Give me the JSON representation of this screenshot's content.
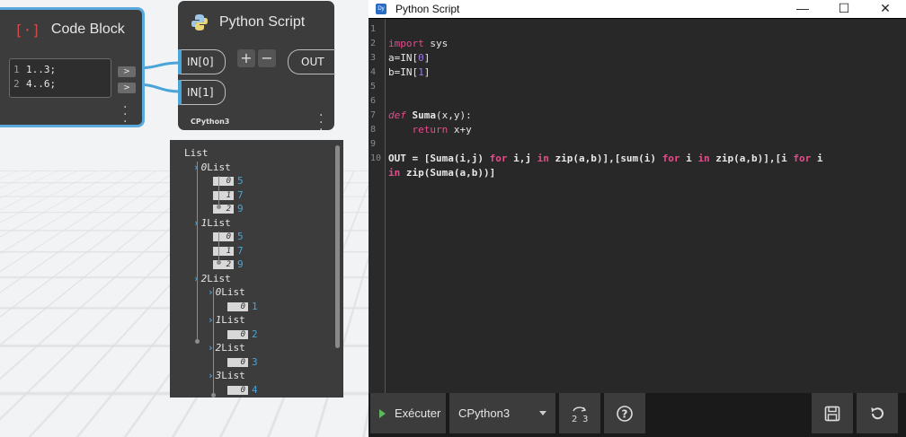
{
  "code_block": {
    "title": "Code Block",
    "icon": "code-block-icon",
    "lines": [
      {
        "num": "1",
        "text": "1..3;"
      },
      {
        "num": "2",
        "text": "4..6;"
      }
    ],
    "out_port_label": ">"
  },
  "python_node": {
    "title": "Python Script",
    "icon": "python-icon",
    "inputs": [
      "IN[0]",
      "IN[1]"
    ],
    "add_label": "+",
    "remove_label": "−",
    "output": "OUT",
    "engine": "CPython3"
  },
  "preview": {
    "rows": [
      {
        "kind": "header",
        "text": "List"
      },
      {
        "kind": "list",
        "index": "0",
        "text": "List"
      },
      {
        "kind": "item",
        "index": "0",
        "value": "5"
      },
      {
        "kind": "item",
        "index": "1",
        "value": "7"
      },
      {
        "kind": "item",
        "index": "2",
        "value": "9"
      },
      {
        "kind": "list",
        "index": "1",
        "text": "List"
      },
      {
        "kind": "item",
        "index": "0",
        "value": "5"
      },
      {
        "kind": "item",
        "index": "1",
        "value": "7"
      },
      {
        "kind": "item",
        "index": "2",
        "value": "9"
      },
      {
        "kind": "list",
        "index": "2",
        "text": "List"
      },
      {
        "kind": "sublist",
        "index": "0",
        "text": "List"
      },
      {
        "kind": "subitem",
        "index": "0",
        "value": "1"
      },
      {
        "kind": "sublist",
        "index": "1",
        "text": "List"
      },
      {
        "kind": "subitem",
        "index": "0",
        "value": "2"
      },
      {
        "kind": "sublist",
        "index": "2",
        "text": "List"
      },
      {
        "kind": "subitem",
        "index": "0",
        "value": "3"
      },
      {
        "kind": "sublist",
        "index": "3",
        "text": "List"
      },
      {
        "kind": "subitem",
        "index": "0",
        "value": "4"
      }
    ]
  },
  "editor": {
    "window_title": "Python Script",
    "app_icon": "dynamo-icon",
    "minimize": "—",
    "maximize": "☐",
    "close": "✕",
    "line_numbers": [
      "1",
      "2",
      "3",
      "4",
      "5",
      "6",
      "7",
      "8",
      "9",
      "10"
    ],
    "toolbar": {
      "run_label": "Exécuter",
      "engine_value": "CPython3",
      "convert_icon": "tab-convert-icon",
      "help_icon": "help-icon",
      "save_icon": "save-icon",
      "revert_icon": "revert-icon"
    }
  },
  "colors": {
    "accent_blue": "#4aa4d8",
    "keyword_pink": "#e64c8c",
    "number_purple": "#9a7ae0",
    "node_bg": "#3c3c3c",
    "run_green": "#5db85d"
  }
}
